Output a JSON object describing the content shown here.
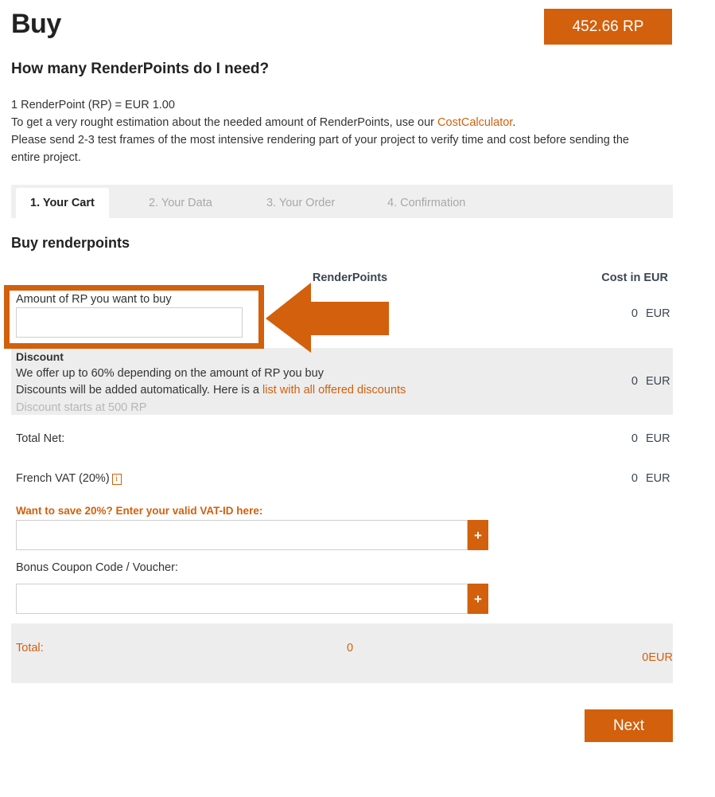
{
  "header": {
    "title": "Buy",
    "rp_balance": "452.66 RP",
    "accent_color": "#d2600c"
  },
  "intro": {
    "heading": "How many RenderPoints do I need?",
    "line1": "1 RenderPoint (RP) = EUR 1.00",
    "line2_before": "To get a very rought estimation about the needed amount of RenderPoints, use our ",
    "line2_link": "CostCalculator",
    "line2_after": ".",
    "line3": "Please send 2-3 test frames of the most intensive rendering part of your project to verify time and cost before sending the entire project."
  },
  "tabs": [
    {
      "label": "1. Your Cart",
      "active": true
    },
    {
      "label": "2. Your Data",
      "active": false
    },
    {
      "label": "3. Your Order",
      "active": false
    },
    {
      "label": "4. Confirmation",
      "active": false
    }
  ],
  "cart": {
    "heading": "Buy renderpoints",
    "columns": {
      "renderpoints": "RenderPoints",
      "cost": "Cost in EUR"
    },
    "amount_row": {
      "label": "Amount of RP you want to buy",
      "input_value": "",
      "input_placeholder": "",
      "cost_amount": "0",
      "cost_currency": "EUR"
    },
    "discount_row": {
      "title": "Discount",
      "line1": "We offer up to 60% depending on the amount of RP you buy",
      "line2_before": "Discounts will be added automatically. Here is a ",
      "line2_link": "list with all offered discounts",
      "line3": "Discount starts at 500 RP",
      "cost_amount": "0",
      "cost_currency": "EUR"
    },
    "total_net_row": {
      "label": "Total Net:",
      "cost_amount": "0",
      "cost_currency": "EUR"
    },
    "vat_row": {
      "label": "French VAT (20%)",
      "info_icon_glyph": "i",
      "cost_amount": "0",
      "cost_currency": "EUR"
    },
    "vat_id": {
      "prompt": "Want to save 20%? Enter your valid VAT-ID here:",
      "input_value": "",
      "input_placeholder": "",
      "add_button_label": "+"
    },
    "coupon": {
      "prompt": "Bonus Coupon Code / Voucher:",
      "input_value": "",
      "input_placeholder": "",
      "add_button_label": "+"
    },
    "total_row": {
      "label": "Total:",
      "renderpoints": "0",
      "cost_amount": "0",
      "cost_currency": "EUR"
    }
  },
  "footer": {
    "next_label": "Next"
  },
  "annotations": {
    "highlight_box_color": "#d2600c",
    "arrow_color": "#d2600c",
    "arrow_direction": "left"
  }
}
